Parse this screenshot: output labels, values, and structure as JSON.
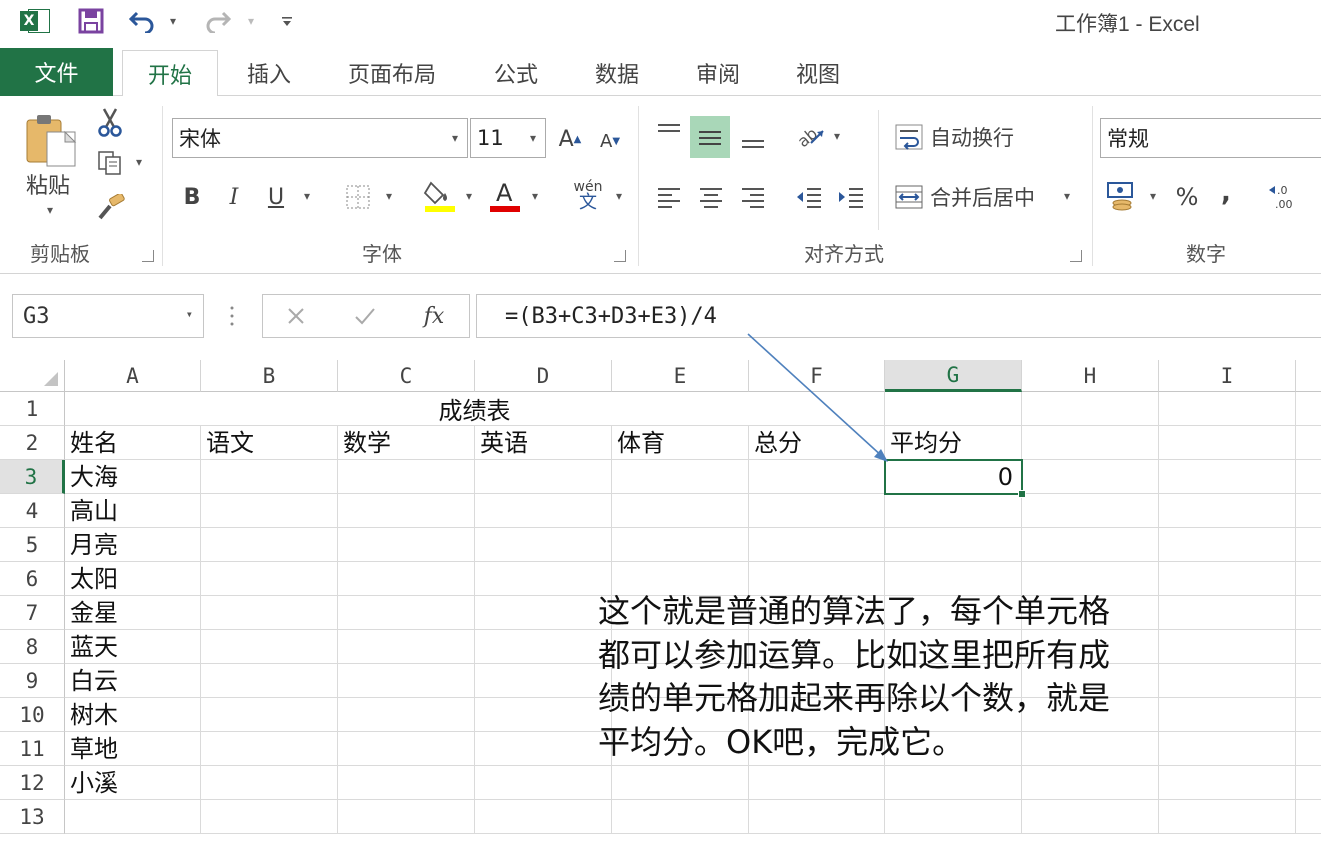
{
  "app": {
    "title": "工作簿1 - Excel",
    "brand_color": "#217346"
  },
  "quick_access": {
    "logo_letter": "X"
  },
  "tabs": [
    {
      "label": "文件"
    },
    {
      "label": "开始"
    },
    {
      "label": "插入"
    },
    {
      "label": "页面布局"
    },
    {
      "label": "公式"
    },
    {
      "label": "数据"
    },
    {
      "label": "审阅"
    },
    {
      "label": "视图"
    }
  ],
  "ribbon": {
    "clipboard": {
      "paste_label": "粘贴",
      "group_label": "剪贴板"
    },
    "font": {
      "font_name": "宋体",
      "font_size": "11",
      "bold": "B",
      "italic": "I",
      "underline": "U",
      "font_color_letter": "A",
      "grow": "A",
      "shrink": "A",
      "wen": "wén",
      "wen_char": "文",
      "group_label": "字体"
    },
    "alignment": {
      "wrap_text": "自动换行",
      "merge_center": "合并后居中",
      "group_label": "对齐方式"
    },
    "number": {
      "format": "常规",
      "percent": "%",
      "comma": ",",
      "group_label": "数字"
    }
  },
  "formula_bar": {
    "name_box": "G3",
    "fx": "fx",
    "formula": "=(B3+C3+D3+E3)/4"
  },
  "grid": {
    "columns": [
      "A",
      "B",
      "C",
      "D",
      "E",
      "F",
      "G",
      "H",
      "I"
    ],
    "rows": [
      "1",
      "2",
      "3",
      "4",
      "5",
      "6",
      "7",
      "8",
      "9",
      "10",
      "11",
      "12",
      "13"
    ],
    "title": "成绩表",
    "headers": [
      "姓名",
      "语文",
      "数学",
      "英语",
      "体育",
      "总分",
      "平均分"
    ],
    "names": [
      "大海",
      "高山",
      "月亮",
      "太阳",
      "金星",
      "蓝天",
      "白云",
      "树木",
      "草地",
      "小溪"
    ],
    "g3_value": "0",
    "selected_cell": "G3"
  },
  "annotation": {
    "lines": [
      "这个就是普通的算法了，每个单元格",
      "都可以参加运算。比如这里把所有成",
      "绩的单元格加起来再除以个数，就是",
      "平均分。OK吧，完成它。"
    ],
    "arrow_color": "#4f81bd"
  }
}
